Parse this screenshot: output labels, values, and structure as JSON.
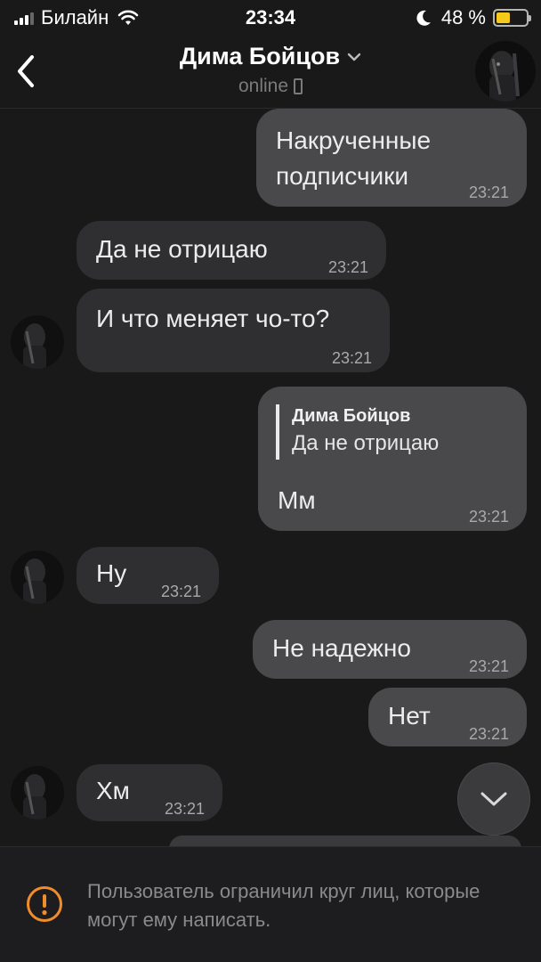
{
  "status_bar": {
    "carrier": "Билайн",
    "time": "23:34",
    "battery_percent": "48 %",
    "battery_level": 0.48
  },
  "header": {
    "contact_name": "Дима Бойцов",
    "status": "online"
  },
  "messages": [
    {
      "direction": "out",
      "text_line1": "Накрученные",
      "text_line2": "подписчики",
      "time": "23:21"
    },
    {
      "direction": "in",
      "text": "Да не отрицаю",
      "time": "23:21"
    },
    {
      "direction": "in",
      "text": "И что меняет чо-то?",
      "time": "23:21"
    },
    {
      "direction": "out",
      "quote_author": "Дима Бойцов",
      "quote_text": "Да не отрицаю",
      "text": "Мм",
      "time": "23:21"
    },
    {
      "direction": "in",
      "text": "Ну",
      "time": "23:21"
    },
    {
      "direction": "out",
      "text": "Не надежно",
      "time": "23:21"
    },
    {
      "direction": "out",
      "text": "Нет",
      "time": "23:21"
    },
    {
      "direction": "in",
      "text": "Хм",
      "time": "23:21"
    }
  ],
  "footer": {
    "notice": "Пользователь ограничил круг лиц, которые могут ему написать."
  },
  "colors": {
    "background": "#19191a",
    "outgoing_bubble": "#49494b",
    "incoming_bubble": "#2f2f31",
    "warning": "#f08c2a",
    "battery": "#f5c919"
  }
}
